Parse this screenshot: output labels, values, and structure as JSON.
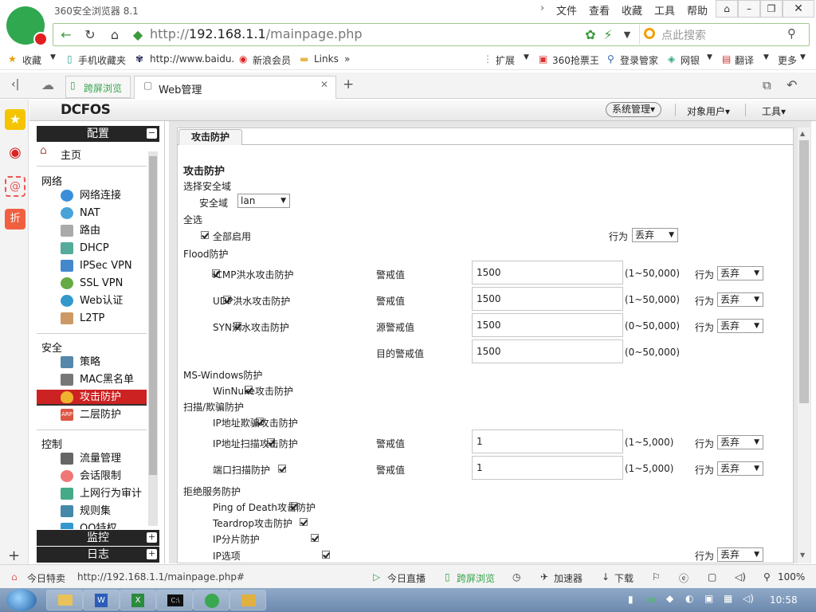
{
  "browser": {
    "title": "360安全浏览器 8.1",
    "menu": [
      "文件",
      "查看",
      "收藏",
      "工具",
      "帮助"
    ],
    "url_prefix": "http://",
    "url_host": "192.168.1.1",
    "url_path": "/mainpage.php",
    "search_placeholder": "点此搜索",
    "bookmarks": [
      "收藏",
      "手机收藏夹",
      "http://www.baidu.",
      "新浪会员",
      "Links"
    ],
    "bookmarks_right": [
      "扩展",
      "360抢票王",
      "登录管家",
      "网银",
      "翻译",
      "更多"
    ],
    "tabs": [
      "跨屏浏览",
      "Web管理"
    ]
  },
  "header": {
    "brand": "DCFOS",
    "menus": [
      "系统管理",
      "对象用户",
      "工具"
    ]
  },
  "nav": {
    "config_header": "配置",
    "home": "主页",
    "network_title": "网络",
    "network": [
      "网络连接",
      "NAT",
      "路由",
      "DHCP",
      "IPSec VPN",
      "SSL VPN",
      "Web认证",
      "L2TP"
    ],
    "security_title": "安全",
    "security": [
      "策略",
      "MAC黑名单",
      "攻击防护",
      "二层防护"
    ],
    "control_title": "控制",
    "control": [
      "流量管理",
      "会话限制",
      "上网行为审计",
      "规则集",
      "QQ特权"
    ],
    "monitor_header": "监控",
    "log_header": "日志"
  },
  "content": {
    "tab": "攻击防护",
    "heading": "攻击防护",
    "zone_section": "选择安全域",
    "zone_label": "安全域",
    "zone_value": "lan",
    "all_section": "全选",
    "all_enable": "全部启用",
    "action_label": "行为",
    "action_value": "丢弃",
    "flood_section": "Flood防护",
    "icmp": "ICMP洪水攻击防护",
    "udp": "UDP洪水攻击防护",
    "syn": "SYN洪水攻击防护",
    "threshold": "警戒值",
    "src_threshold": "源警戒值",
    "dst_threshold": "目的警戒值",
    "val_1500": "1500",
    "range_50000_1": "(1~50,000)",
    "range_50000_0": "(0~50,000)",
    "mswin_section": "MS-Windows防护",
    "winnuke": "WinNuke攻击防护",
    "scan_section": "扫描/欺骗防护",
    "ip_spoof": "IP地址欺骗攻击防护",
    "ip_scan": "IP地址扫描攻击防护",
    "port_scan": "端口扫描防护",
    "val_1": "1",
    "range_5000": "(1~5,000)",
    "dos_section": "拒绝服务防护",
    "ping_death": "Ping of Death攻击防护",
    "teardrop": "Teardrop攻击防护",
    "ip_frag": "IP分片防护",
    "ip_opt": "IP选项"
  },
  "status": {
    "left": "今日特卖",
    "url": "http://192.168.1.1/mainpage.php#",
    "live": "今日直播",
    "cross": "跨屏浏览",
    "accel": "加速器",
    "download": "下载",
    "zoom": "100%"
  },
  "taskbar": {
    "time": "10:58"
  }
}
